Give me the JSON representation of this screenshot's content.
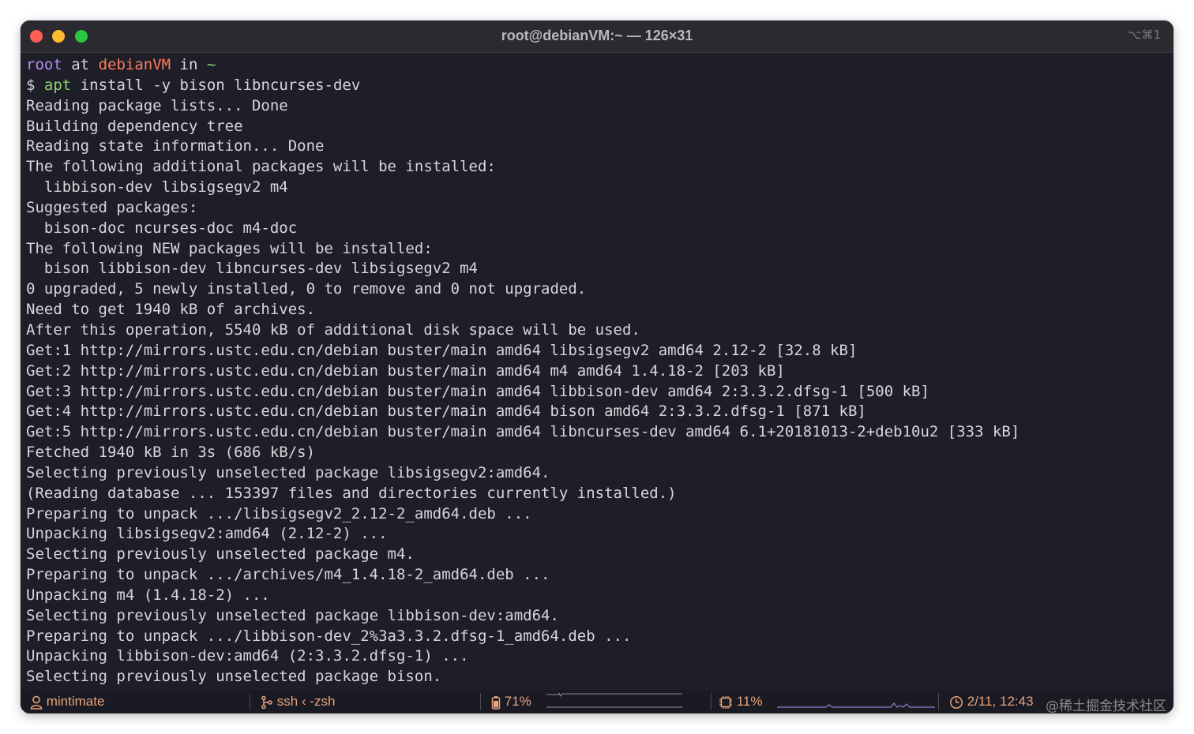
{
  "window": {
    "title": "root@debianVM:~ — 126×31",
    "shortcut": "⌥⌘1"
  },
  "prompt": {
    "user": "root",
    "at": "at",
    "host": "debianVM",
    "in": "in",
    "path": "~",
    "symbol": "$",
    "command_name": "apt",
    "command_args": "install -y bison libncurses-dev"
  },
  "output_lines": [
    "Reading package lists... Done",
    "Building dependency tree",
    "Reading state information... Done",
    "The following additional packages will be installed:",
    "  libbison-dev libsigsegv2 m4",
    "Suggested packages:",
    "  bison-doc ncurses-doc m4-doc",
    "The following NEW packages will be installed:",
    "  bison libbison-dev libncurses-dev libsigsegv2 m4",
    "0 upgraded, 5 newly installed, 0 to remove and 0 not upgraded.",
    "Need to get 1940 kB of archives.",
    "After this operation, 5540 kB of additional disk space will be used.",
    "Get:1 http://mirrors.ustc.edu.cn/debian buster/main amd64 libsigsegv2 amd64 2.12-2 [32.8 kB]",
    "Get:2 http://mirrors.ustc.edu.cn/debian buster/main amd64 m4 amd64 1.4.18-2 [203 kB]",
    "Get:3 http://mirrors.ustc.edu.cn/debian buster/main amd64 libbison-dev amd64 2:3.3.2.dfsg-1 [500 kB]",
    "Get:4 http://mirrors.ustc.edu.cn/debian buster/main amd64 bison amd64 2:3.3.2.dfsg-1 [871 kB]",
    "Get:5 http://mirrors.ustc.edu.cn/debian buster/main amd64 libncurses-dev amd64 6.1+20181013-2+deb10u2 [333 kB]",
    "Fetched 1940 kB in 3s (686 kB/s)",
    "Selecting previously unselected package libsigsegv2:amd64.",
    "(Reading database ... 153397 files and directories currently installed.)",
    "Preparing to unpack .../libsigsegv2_2.12-2_amd64.deb ...",
    "Unpacking libsigsegv2:amd64 (2.12-2) ...",
    "Selecting previously unselected package m4.",
    "Preparing to unpack .../archives/m4_1.4.18-2_amd64.deb ...",
    "Unpacking m4 (1.4.18-2) ...",
    "Selecting previously unselected package libbison-dev:amd64.",
    "Preparing to unpack .../libbison-dev_2%3a3.3.2.dfsg-1_amd64.deb ...",
    "Unpacking libbison-dev:amd64 (2:3.3.2.dfsg-1) ...",
    "Selecting previously unselected package bison."
  ],
  "status_bar": {
    "user": "mintimate",
    "process": "ssh ‹ -zsh",
    "battery": "71%",
    "battery_level": 0.71,
    "cpu": "11%",
    "cpu_level": 0.11,
    "datetime": "2/11, 12:43",
    "accent_color": "#e7a37c",
    "icons": [
      "user-icon",
      "branch-icon",
      "battery-icon",
      "cpu-icon",
      "clock-icon"
    ]
  },
  "watermark": "@稀土掘金技术社区"
}
